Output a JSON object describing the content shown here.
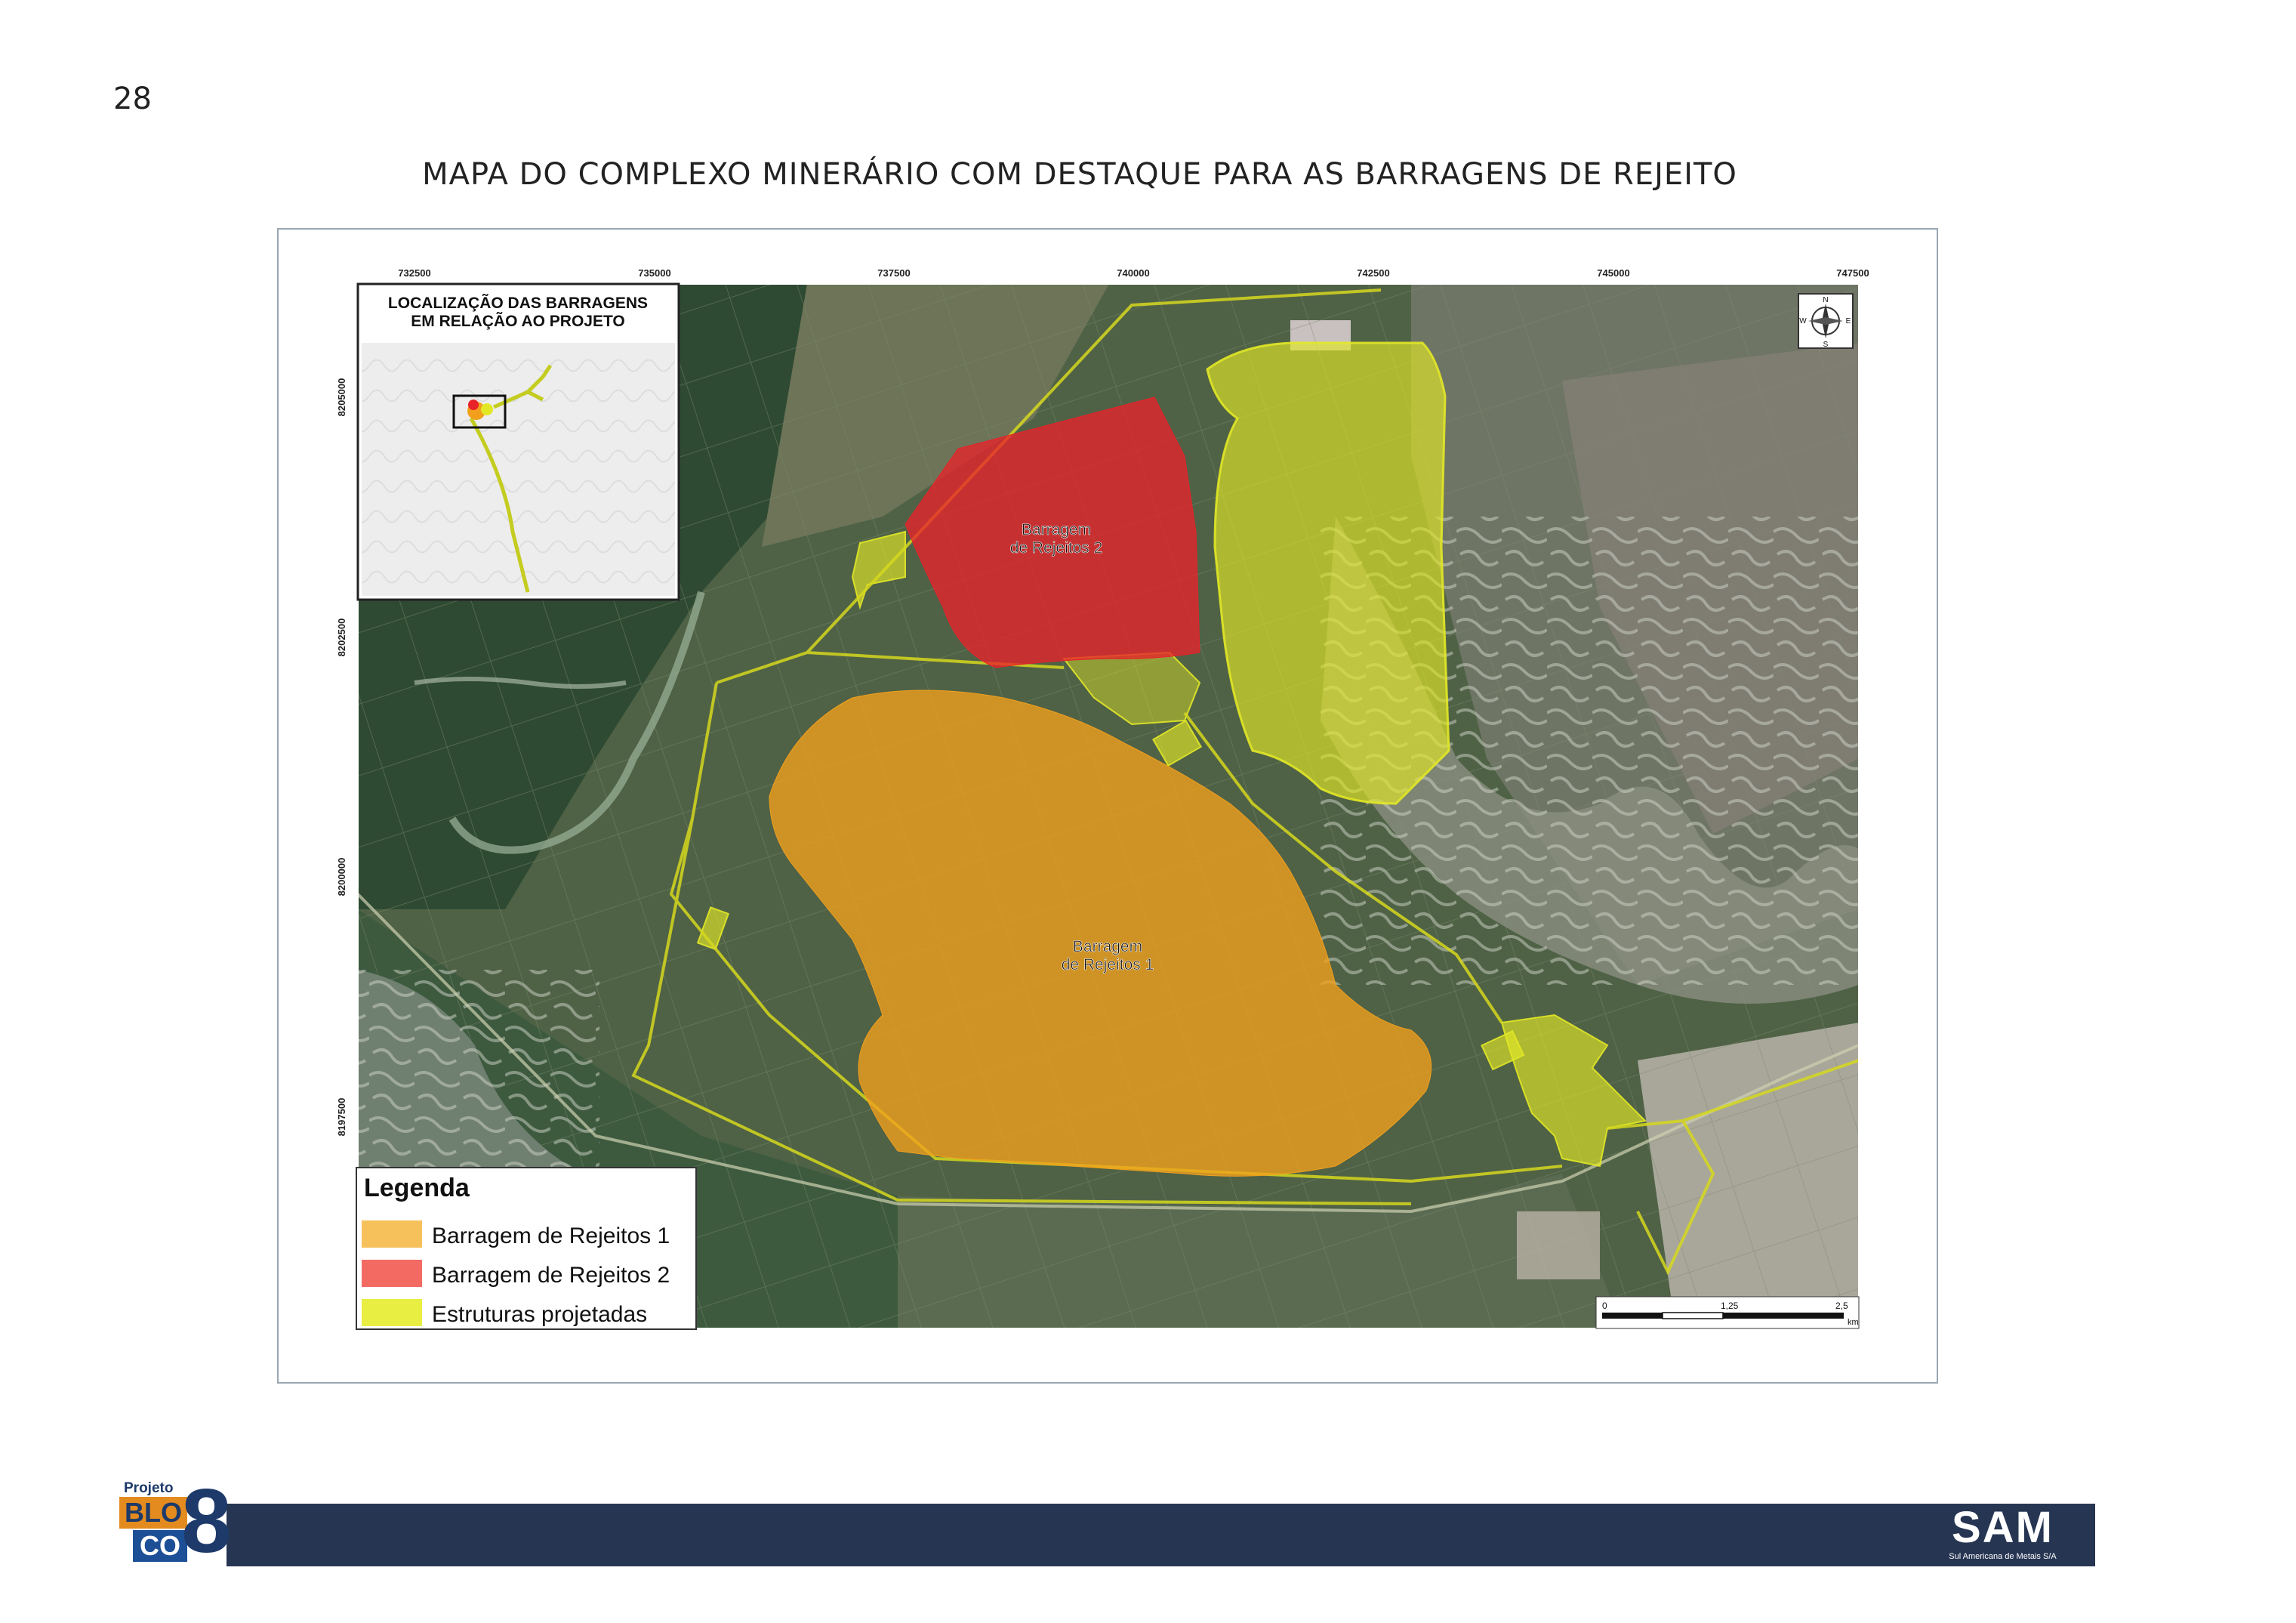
{
  "page": {
    "number": "28",
    "title": "MAPA DO COMPLEXO MINERÁRIO COM DESTAQUE PARA AS BARRAGENS DE REJEITO"
  },
  "map": {
    "x_ticks": [
      "732500",
      "735000",
      "737500",
      "740000",
      "742500",
      "745000",
      "747500"
    ],
    "y_ticks": [
      "8205000",
      "8202500",
      "8200000",
      "8197500"
    ],
    "inset_title_line1": "LOCALIZAÇÃO DAS BARRAGENS",
    "inset_title_line2": "EM RELAÇÃO AO PROJETO",
    "label_dam2_line1": "Barragem",
    "label_dam2_line2": "de Rejeitos 2",
    "label_dam1_line1": "Barragem",
    "label_dam1_line2": "de Rejeitos 1",
    "compass": {
      "n": "N",
      "s": "S",
      "e": "E",
      "w": "W"
    },
    "scale": {
      "labels": [
        "0",
        "1,25",
        "2,5"
      ],
      "unit": "km"
    },
    "legend": {
      "title": "Legenda",
      "items": [
        {
          "label": "Barragem de Rejeitos 1",
          "color": "#f6c15a"
        },
        {
          "label": "Barragem de Rejeitos 2",
          "color": "#f36a63"
        },
        {
          "label": "Estruturas projetadas",
          "color": "#e9ee42"
        }
      ]
    },
    "colors": {
      "dam1": "#f2a01c",
      "dam2": "#e8232a",
      "structures": "#e2e826",
      "footer": "#263552"
    }
  },
  "footer": {
    "bloco_projeto": "Projeto",
    "bloco_blo": "BLO",
    "bloco_co": "CO",
    "bloco_eight": "8",
    "sam": "SAM",
    "sam_sub": "Sul Americana de Metais S/A"
  }
}
